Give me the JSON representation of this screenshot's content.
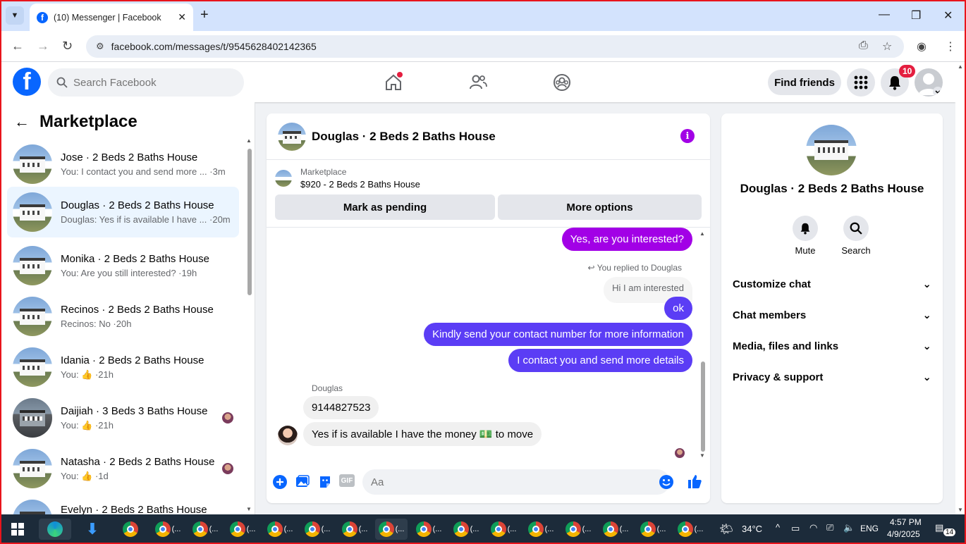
{
  "browser": {
    "tab_title": "(10) Messenger | Facebook",
    "url": "facebook.com/messages/t/9545628402142365"
  },
  "fb_header": {
    "search_placeholder": "Search Facebook",
    "find_friends": "Find friends",
    "notification_count": "10"
  },
  "sidebar": {
    "title": "Marketplace",
    "conversations": [
      {
        "name": "Jose · 2 Beds 2 Baths House",
        "snippet": "You: I contact you and send more ... ·3m"
      },
      {
        "name": "Douglas · 2 Beds 2 Baths House",
        "snippet": "Douglas: Yes if is available I have ... ·20m"
      },
      {
        "name": "Monika · 2 Beds 2 Baths House",
        "snippet": "You: Are you still interested? ·19h"
      },
      {
        "name": "Recinos · 2 Beds 2 Baths House",
        "snippet": "Recinos: No ·20h"
      },
      {
        "name": "Idania · 2 Beds 2 Baths House",
        "snippet": "You: 👍 ·21h"
      },
      {
        "name": "Daijiah · 3 Beds 3 Baths House",
        "snippet": "You: 👍 ·21h"
      },
      {
        "name": "Natasha · 2 Beds 2 Baths House",
        "snippet": "You: 👍 ·1d"
      },
      {
        "name": "Evelyn · 2 Beds 2 Baths House",
        "snippet": ""
      }
    ]
  },
  "chat": {
    "title": "Douglas · 2 Beds 2 Baths House",
    "marketplace_label": "Marketplace",
    "listing": "$920 - 2 Beds 2 Baths House",
    "mark_pending": "Mark as pending",
    "more_options": "More options",
    "messages": {
      "m1": "Yes, are you interested?",
      "replied_to": "You replied to Douglas",
      "quote": "Hi I am interested",
      "m2": "ok",
      "m3": "Kindly send your contact number for more information",
      "m4": "I contact you and send more details",
      "sender": "Douglas",
      "in1": "9144827523",
      "in2": "Yes if is available I have the money 💵 to move"
    },
    "composer_placeholder": "Aa",
    "gif_label": "GIF"
  },
  "info_panel": {
    "name": "Douglas · 2 Beds 2 Baths House",
    "mute": "Mute",
    "search": "Search",
    "sections": [
      "Customize chat",
      "Chat members",
      "Media, files and links",
      "Privacy & support"
    ]
  },
  "taskbar": {
    "temperature": "34°C",
    "language": "ENG",
    "time": "4:57 PM",
    "date": "4/9/2025",
    "notif": "14"
  },
  "colors": {
    "fb_blue": "#0866ff",
    "purple_bubble": "#a200e6",
    "blue_bubble": "#5b3df5",
    "badge_red": "#e41e3f"
  }
}
